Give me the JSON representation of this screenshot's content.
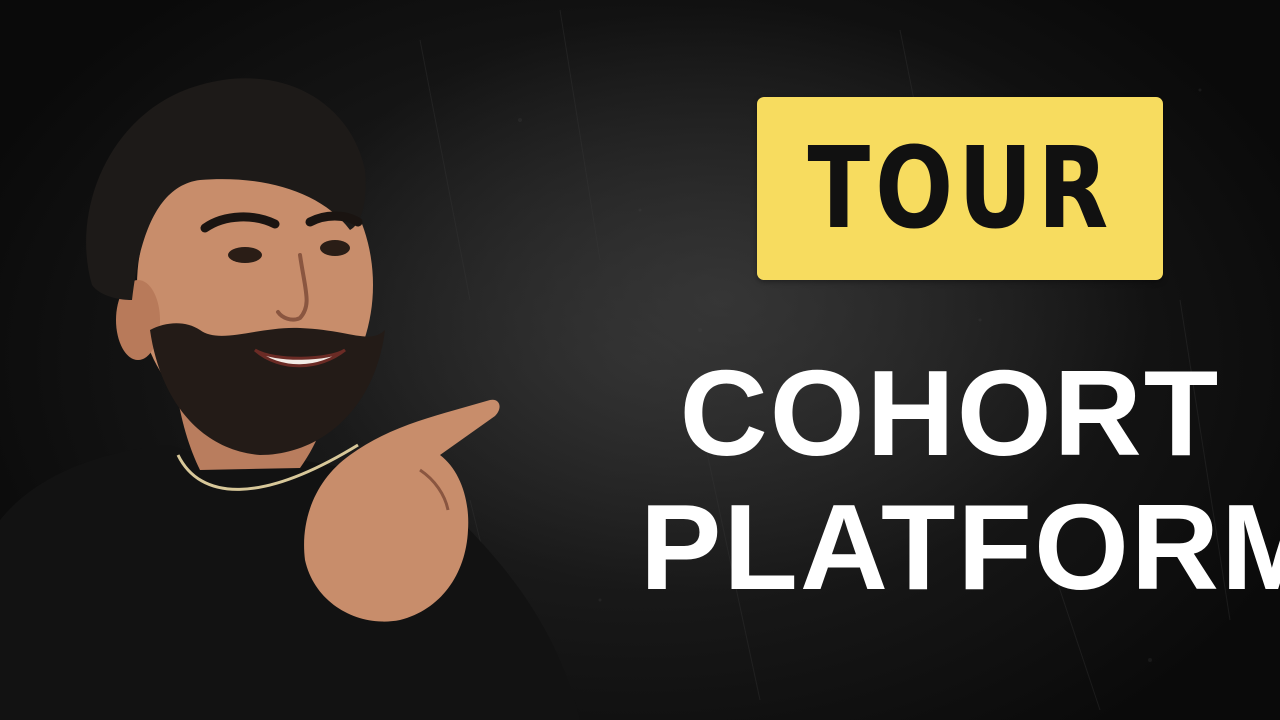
{
  "thumbnail": {
    "badge": {
      "label": "TOUR",
      "background_color": "#f7dc5f",
      "text_color": "#111111"
    },
    "headline": {
      "line1": "COHORT",
      "line2": "PLATFORM",
      "color": "#ffffff"
    },
    "background_color": "#151515",
    "presenter": {
      "icon": "person-pointing-icon"
    }
  }
}
